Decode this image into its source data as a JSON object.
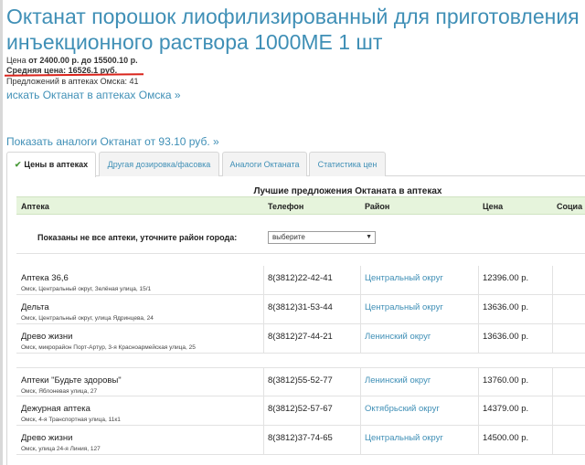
{
  "product": {
    "title": "Октанат порошок лиофилизированный для приготовления инъекционного раствора 1000МЕ 1 шт",
    "price_prefix": "Цена ",
    "price_range": "от 2400.00 р. до 15500.10 р.",
    "avg_price": "Средняя цена: 16526.1 руб.",
    "offers": "Предложений в аптеках Омска: 41"
  },
  "links": {
    "search_link": "искать Октанат в аптеках Омска »",
    "analog_link": "Показать аналоги Октанат от 93.10 руб. »"
  },
  "tabs": [
    {
      "label": "Цены в аптеках",
      "active": true
    },
    {
      "label": "Другая дозировка/фасовка",
      "active": false
    },
    {
      "label": "Аналоги Октаната",
      "active": false
    },
    {
      "label": "Статистика цен",
      "active": false
    }
  ],
  "table": {
    "caption": "Лучшие предложения Октаната в аптеках",
    "columns": [
      "Аптека",
      "Телефон",
      "Район",
      "Цена",
      "Социа"
    ],
    "filter_label": "Показаны не все аптеки, уточните район города:",
    "filter_select": "выберите",
    "rows": [
      {
        "name": "Аптека 36,6",
        "address": "Омск, Центральный округ, Зелёная улица, 15/1",
        "phone": "8(3812)22-42-41",
        "district": "Центральный округ",
        "price": "12396.00 р."
      },
      {
        "name": "Дельта",
        "address": "Омск, Центральный округ, улица Ядринцева, 24",
        "phone": "8(3812)31-53-44",
        "district": "Центральный округ",
        "price": "13636.00 р."
      },
      {
        "name": "Древо жизни",
        "address": "Омск, микрорайон Порт-Артур, 3-я Красноармейская улица, 25",
        "phone": "8(3812)27-44-21",
        "district": "Ленинский округ",
        "price": "13636.00 р."
      },
      {
        "name": "Аптеки \"Будьте здоровы\"",
        "address": "Омск, Яблоневая улица, 27",
        "phone": "8(3812)55-52-77",
        "district": "Ленинский округ",
        "price": "13760.00 р."
      },
      {
        "name": "Дежурная аптека",
        "address": "Омск, 4-я Транспортная улица, 11к1",
        "phone": "8(3812)52-57-67",
        "district": "Октябрьский округ",
        "price": "14379.00 р."
      },
      {
        "name": "Древо жизни",
        "address": "Омск, улица 24-я Линия, 127",
        "phone": "8(3812)37-74-65",
        "district": "Центральный округ",
        "price": "14500.00 р."
      }
    ]
  },
  "icons": {
    "active_tab_icon": "checkmark-icon",
    "select_icon": "dropdown-arrow-icon"
  }
}
